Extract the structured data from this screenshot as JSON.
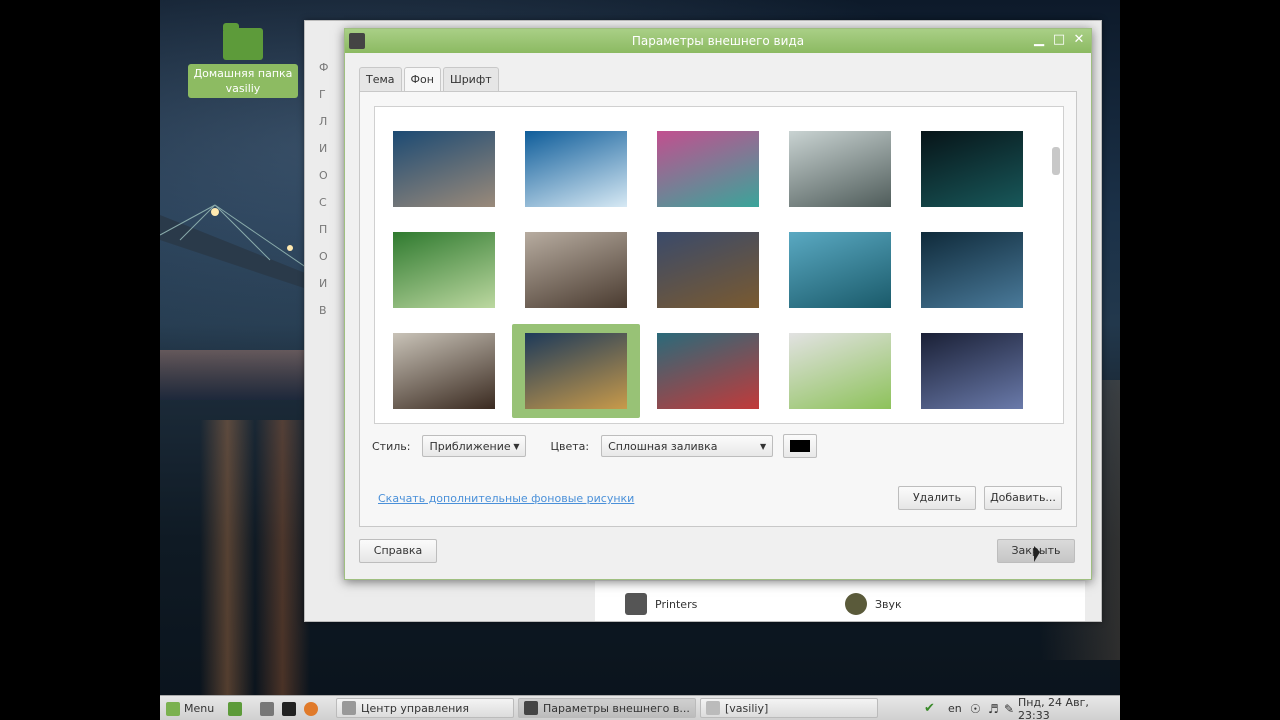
{
  "desktop": {
    "home_folder_line1": "Домашняя папка",
    "home_folder_line2": "vasiliy"
  },
  "background_window": {
    "left_letters": [
      "Ф",
      "Г",
      "Л",
      "И",
      "О",
      "С",
      "П",
      "О",
      "И",
      "В"
    ],
    "items": [
      {
        "label": "Printers",
        "icon": "printer-icon"
      },
      {
        "label": "Звук",
        "icon": "speaker-icon"
      }
    ]
  },
  "dialog": {
    "title": "Параметры внешнего вида",
    "tabs": [
      {
        "label": "Тема",
        "active": false
      },
      {
        "label": "Фон",
        "active": true
      },
      {
        "label": "Шрифт",
        "active": false
      }
    ],
    "thumbnails": [
      {
        "name": "wallpaper-1",
        "colors": [
          "#1c4a73",
          "#9a8a7a"
        ]
      },
      {
        "name": "wallpaper-2",
        "colors": [
          "#0f5d9a",
          "#d7e9f4"
        ]
      },
      {
        "name": "wallpaper-3",
        "colors": [
          "#c24f8f",
          "#3aa59a"
        ]
      },
      {
        "name": "wallpaper-4",
        "colors": [
          "#c9d3d2",
          "#4f5c5a"
        ]
      },
      {
        "name": "wallpaper-5",
        "colors": [
          "#071418",
          "#18585a"
        ]
      },
      {
        "name": "wallpaper-6",
        "colors": [
          "#2f7a2f",
          "#bcd8a0"
        ]
      },
      {
        "name": "wallpaper-7",
        "colors": [
          "#b7aca0",
          "#4a3b30"
        ]
      },
      {
        "name": "wallpaper-8",
        "colors": [
          "#3a4a6a",
          "#7a5a30"
        ]
      },
      {
        "name": "wallpaper-9",
        "colors": [
          "#5aa9c2",
          "#1a5a6a"
        ]
      },
      {
        "name": "wallpaper-10",
        "colors": [
          "#0f2a3a",
          "#4a7a9a"
        ]
      },
      {
        "name": "wallpaper-11",
        "colors": [
          "#c9c3b8",
          "#3a2a20"
        ]
      },
      {
        "name": "wallpaper-12",
        "colors": [
          "#1d3a5a",
          "#c89a4a"
        ]
      },
      {
        "name": "wallpaper-13",
        "colors": [
          "#2a6a7a",
          "#c23a3a"
        ]
      },
      {
        "name": "wallpaper-14",
        "colors": [
          "#e2e2e2",
          "#8dc25a"
        ]
      },
      {
        "name": "wallpaper-15",
        "colors": [
          "#1a2036",
          "#6a7aaa"
        ]
      }
    ],
    "selected_index": 11,
    "style_label": "Стиль:",
    "style_value": "Приближение",
    "colors_label": "Цвета:",
    "colors_value": "Сплошная заливка",
    "color_swatch": "#000000",
    "download_link": "Скачать дополнительные фоновые рисунки",
    "remove_button": "Удалить",
    "add_button": "Добавить...",
    "help_button": "Справка",
    "close_button": "Закрыть"
  },
  "taskbar": {
    "menu_label": "Menu",
    "windows": [
      {
        "label": "Центр управления",
        "active": false
      },
      {
        "label": "Параметры внешнего в...",
        "active": true
      },
      {
        "label": "[vasiliy]",
        "active": false
      }
    ],
    "keyboard_layout": "en",
    "clock": "Пнд, 24 Авг, 23:33"
  }
}
